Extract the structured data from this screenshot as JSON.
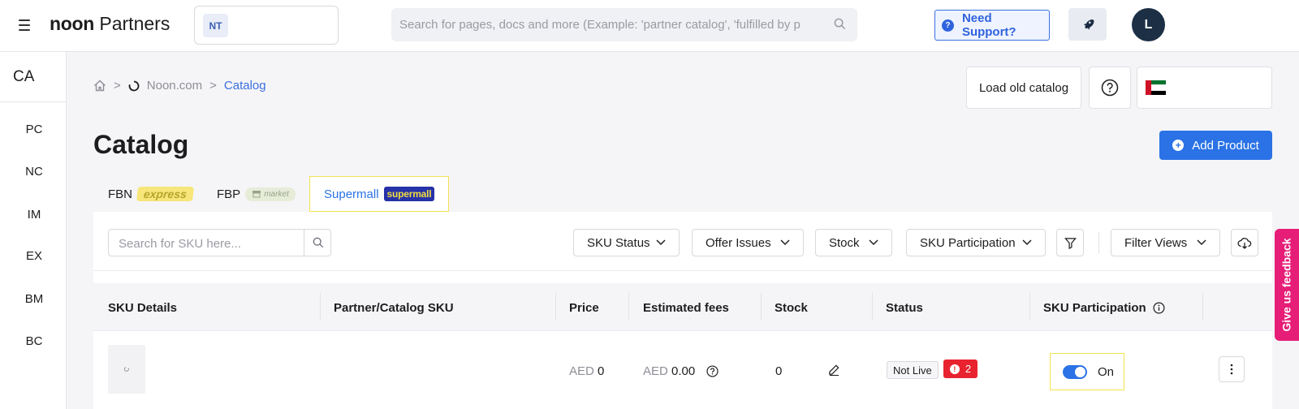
{
  "header": {
    "brand_strong": "noon",
    "brand_rest": " Partners",
    "store_initials": "NT",
    "search_placeholder": "Search for pages, docs and more (Example: 'partner catalog', 'fulfilled by p",
    "support_label": "Need Support?",
    "avatar_initial": "L"
  },
  "sidebar": {
    "title": "CA",
    "items": [
      "PC",
      "NC",
      "IM",
      "EX",
      "BM",
      "BC"
    ]
  },
  "breadcrumb": {
    "separator": ">",
    "site": "Noon.com",
    "current": "Catalog"
  },
  "actions": {
    "load_old": "Load old catalog",
    "help_glyph": "?",
    "add_product": "Add Product"
  },
  "page_title": "Catalog",
  "tabs": [
    {
      "label": "FBN",
      "badge": "express"
    },
    {
      "label": "FBP",
      "badge": "market"
    },
    {
      "label": "Supermall",
      "badge": "supermall"
    }
  ],
  "filters": {
    "sku_search_placeholder": "Search for SKU here...",
    "sku_status": "SKU Status",
    "offer_issues": "Offer Issues",
    "stock": "Stock",
    "sku_participation": "SKU Participation",
    "filter_views": "Filter Views"
  },
  "table": {
    "headers": [
      "SKU Details",
      "Partner/Catalog SKU",
      "Price",
      "Estimated fees",
      "Stock",
      "Status",
      "SKU Participation"
    ],
    "rows": [
      {
        "price_currency": "AED",
        "price_value": "0",
        "fees_currency": "AED",
        "fees_value": "0.00",
        "stock": "0",
        "status": "Not Live",
        "issues_count": "2",
        "participation": "On"
      }
    ]
  },
  "feedback_label": "Give us feedback",
  "colors": {
    "primary": "#2a72e5",
    "feedback": "#e61e77",
    "error": "#e8232f",
    "highlight_border": "#f3e250"
  }
}
